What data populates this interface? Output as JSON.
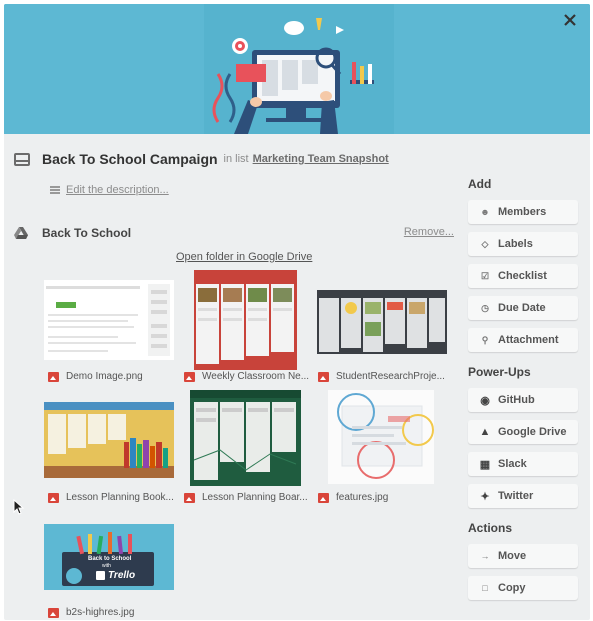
{
  "card": {
    "title": "Back To School Campaign",
    "in_list_prefix": "in list",
    "list_name": "Marketing Team Snapshot",
    "edit_description": "Edit the description..."
  },
  "attachment_section": {
    "title": "Back To School",
    "remove": "Remove...",
    "open_folder": "Open folder in Google Drive",
    "files": [
      {
        "name": "Demo Image.png"
      },
      {
        "name": "Weekly Classroom Ne..."
      },
      {
        "name": "StudentResearchProje..."
      },
      {
        "name": "Lesson Planning Book..."
      },
      {
        "name": "Lesson Planning Boar..."
      },
      {
        "name": "features.jpg"
      },
      {
        "name": "b2s-highres.jpg"
      }
    ],
    "promo_line1": "Back to School",
    "promo_line2": "with",
    "promo_brand": "Trello"
  },
  "sidebar": {
    "add_heading": "Add",
    "add_items": [
      {
        "label": "Members",
        "icon": "person-icon"
      },
      {
        "label": "Labels",
        "icon": "tag-icon"
      },
      {
        "label": "Checklist",
        "icon": "checkbox-icon"
      },
      {
        "label": "Due Date",
        "icon": "clock-icon"
      },
      {
        "label": "Attachment",
        "icon": "paperclip-icon"
      }
    ],
    "powerups_heading": "Power-Ups",
    "powerups": [
      {
        "label": "GitHub",
        "icon": "github-icon"
      },
      {
        "label": "Google Drive",
        "icon": "google-drive-icon"
      },
      {
        "label": "Slack",
        "icon": "slack-icon"
      },
      {
        "label": "Twitter",
        "icon": "twitter-icon"
      }
    ],
    "actions_heading": "Actions",
    "actions": [
      {
        "label": "Move",
        "icon": "arrow-right-icon"
      },
      {
        "label": "Copy",
        "icon": "copy-icon"
      }
    ]
  },
  "colors": {
    "cover": "#5db8d3",
    "panel": "#edeff0",
    "file_icon": "#d9453a"
  }
}
